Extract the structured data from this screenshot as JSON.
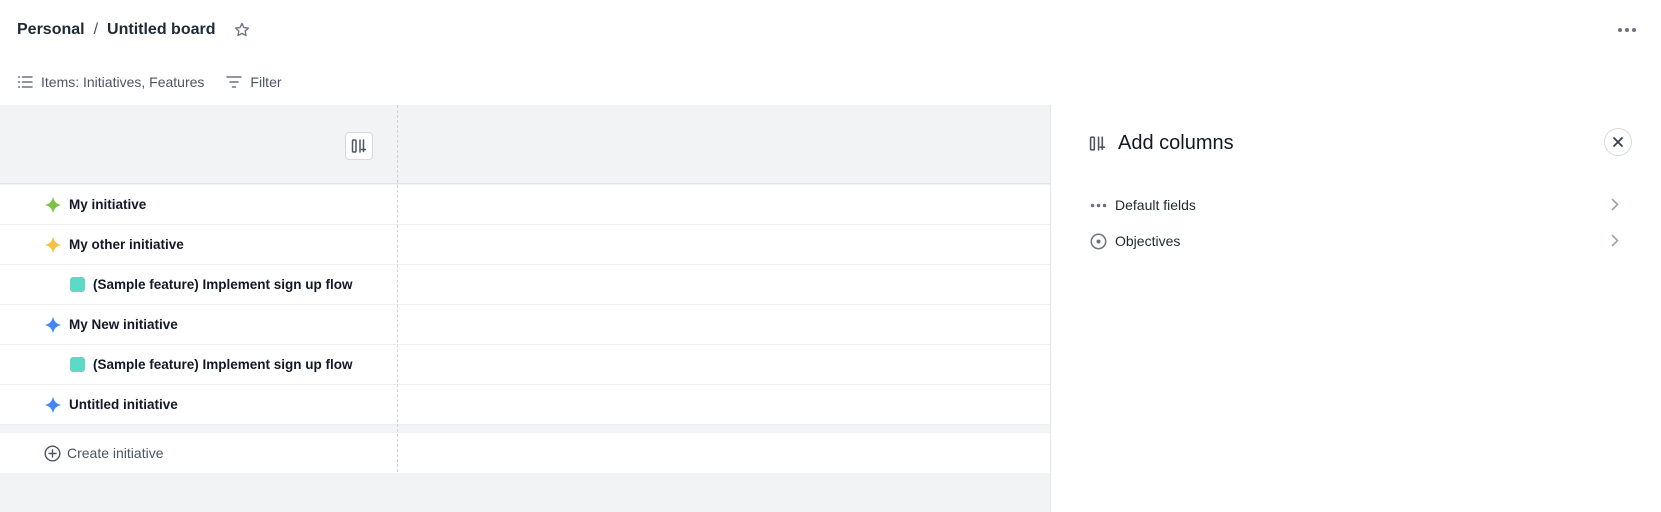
{
  "header": {
    "breadcrumb_root": "Personal",
    "breadcrumb_separator": "/",
    "board_title": "Untitled board"
  },
  "toolbar": {
    "items_label": "Items: Initiatives, Features",
    "filter_label": "Filter"
  },
  "rows": [
    {
      "label": "My initiative",
      "type": "initiative",
      "icon": "sparkle-icon",
      "color": "#7cc243"
    },
    {
      "label": "My other initiative",
      "type": "initiative",
      "icon": "sparkle-icon",
      "color": "#f6c142"
    },
    {
      "label": "(Sample feature) Implement sign up flow",
      "type": "feature",
      "icon": "square-icon",
      "color": "#5fd9c7"
    },
    {
      "label": "My New initiative",
      "type": "initiative",
      "icon": "sparkle-icon",
      "color": "#4285f4"
    },
    {
      "label": "(Sample feature) Implement sign up flow",
      "type": "feature",
      "icon": "square-icon",
      "color": "#5fd9c7"
    },
    {
      "label": "Untitled initiative",
      "type": "initiative",
      "icon": "sparkle-icon",
      "color": "#4285f4"
    }
  ],
  "create_label": "Create initiative",
  "panel": {
    "title": "Add columns",
    "items": [
      {
        "label": "Default fields",
        "icon": "dots-icon"
      },
      {
        "label": "Objectives",
        "icon": "target-icon"
      }
    ]
  }
}
